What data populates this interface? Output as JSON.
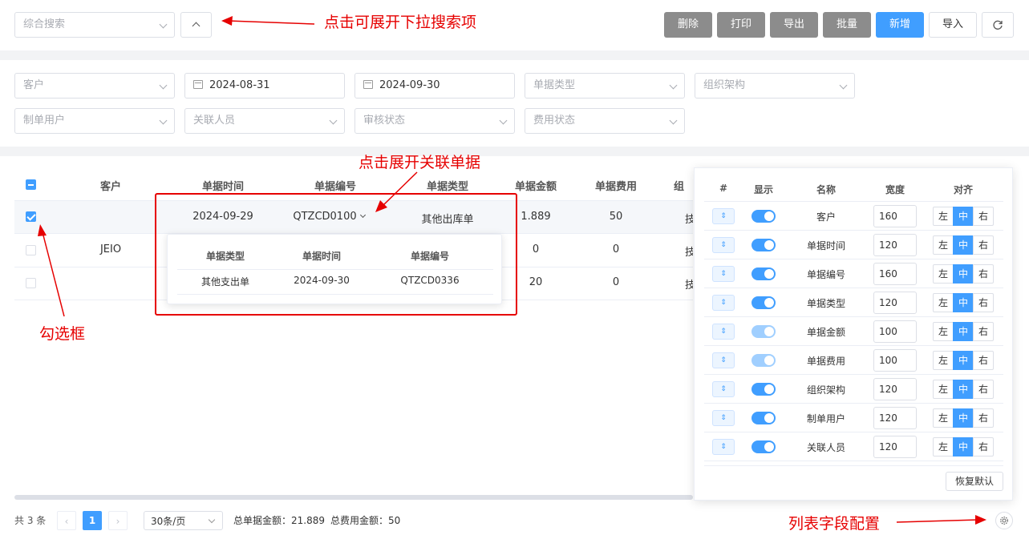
{
  "toolbar": {
    "search_placeholder": "综合搜索",
    "buttons": [
      "删除",
      "打印",
      "导出",
      "批量",
      "新增",
      "导入"
    ]
  },
  "filters": {
    "customer": "客户",
    "date_start": "2024-08-31",
    "date_end": "2024-09-30",
    "doc_type": "单据类型",
    "org": "组织架构",
    "creator": "制单用户",
    "related_person": "关联人员",
    "audit_status": "审核状态",
    "fee_status": "费用状态"
  },
  "table": {
    "columns": [
      "客户",
      "单据时间",
      "单据编号",
      "单据类型",
      "单据金额",
      "单据费用",
      "组"
    ],
    "rows": [
      {
        "customer": "",
        "date": "2024-09-29",
        "code": "QTZCD0100",
        "type": "其他出库单",
        "amount": "1.889",
        "fee": "50",
        "org": "技",
        "checked": true
      },
      {
        "customer": "JEIO",
        "amount": "0",
        "fee": "0",
        "org": "技",
        "checked": false
      },
      {
        "customer": "",
        "amount": "20",
        "fee": "0",
        "org": "技",
        "checked": false
      }
    ]
  },
  "popup": {
    "columns": [
      "单据类型",
      "单据时间",
      "单据编号"
    ],
    "row": [
      "其他支出单",
      "2024-09-30",
      "QTZCD0336"
    ]
  },
  "config": {
    "headers": [
      "#",
      "显示",
      "名称",
      "宽度",
      "对齐"
    ],
    "align_labels": [
      "左",
      "中",
      "右"
    ],
    "rows": [
      {
        "name": "客户",
        "width": "160"
      },
      {
        "name": "单据时间",
        "width": "120"
      },
      {
        "name": "单据编号",
        "width": "160"
      },
      {
        "name": "单据类型",
        "width": "120"
      },
      {
        "name": "单据金额",
        "width": "100"
      },
      {
        "name": "单据费用",
        "width": "100"
      },
      {
        "name": "组织架构",
        "width": "120"
      },
      {
        "name": "制单用户",
        "width": "120"
      },
      {
        "name": "关联人员",
        "width": "120"
      }
    ],
    "reset_label": "恢复默认"
  },
  "footer": {
    "total": "共 3 条",
    "page": "1",
    "page_size": "30条/页",
    "sum_amount": "总单据金额：21.889",
    "sum_fee": "总费用金额：50"
  },
  "annotations": {
    "expand_search": "点击可展开下拉搜索项",
    "expand_related": "点击展开关联单据",
    "checkbox": "勾选框",
    "column_config": "列表字段配置"
  },
  "colors": {
    "primary": "#409eff",
    "gray_button": "#8c8c8c",
    "annotation": "#e60000"
  }
}
